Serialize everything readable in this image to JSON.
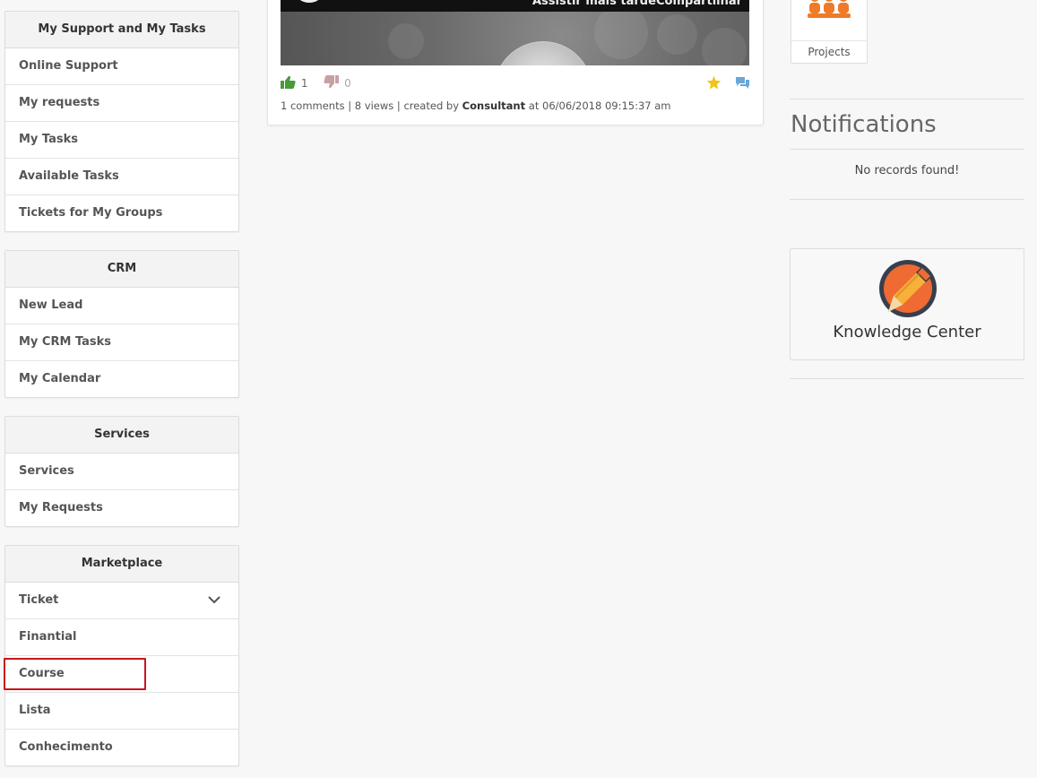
{
  "sidebar": {
    "panels": [
      {
        "title": "My Support and My Tasks",
        "items": [
          "Online Support",
          "My requests",
          "My Tasks",
          "Available Tasks",
          "Tickets for My Groups"
        ]
      },
      {
        "title": "CRM",
        "items": [
          "New Lead",
          "My CRM Tasks",
          "My Calendar"
        ]
      },
      {
        "title": "Services",
        "items": [
          "Services",
          "My Requests"
        ]
      },
      {
        "title": "Marketplace",
        "items": [
          "Ticket",
          "Finantial",
          "Course",
          "Lista",
          "Conhecimento"
        ]
      }
    ],
    "highlighted_item": "Course",
    "expandable_item": "Ticket"
  },
  "video_post": {
    "overlay": {
      "watch_later": "Assistir mais tarde",
      "share": "Compartilhar"
    },
    "likes": "1",
    "dislikes": "0",
    "meta": {
      "comments": "1 comments",
      "views": "8 views",
      "created_by_prefix": "created by",
      "author": "Consultant",
      "at_prefix": "at",
      "timestamp": "06/06/2018 09:15:37 am"
    },
    "icons": [
      "thumbs-up-icon",
      "thumbs-down-icon",
      "star-icon",
      "comments-icon"
    ]
  },
  "right_column": {
    "projects_tile_label": "Projects",
    "notifications_title": "Notifications",
    "notifications_empty": "No records found!",
    "knowledge_center_label": "Knowledge Center"
  },
  "colors": {
    "like_green": "#4a9a3a",
    "dislike_pink": "#c9a0a0",
    "star_yellow": "#f0c419",
    "comment_blue": "#6aa6d8",
    "highlight_red": "#c8161d",
    "projects_orange": "#f07a28"
  }
}
